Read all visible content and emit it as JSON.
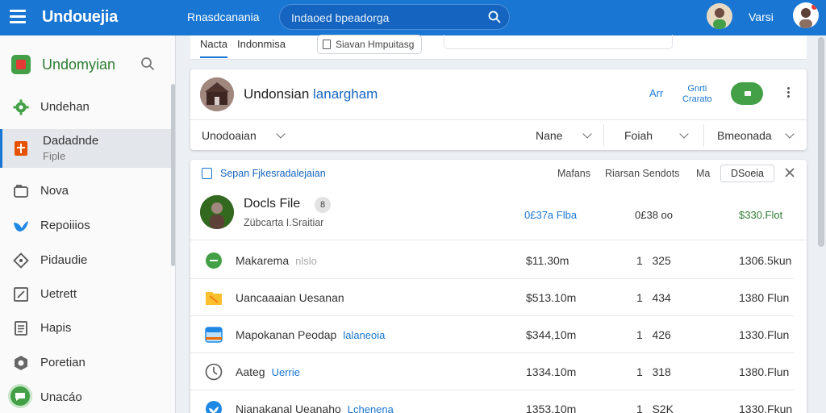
{
  "topbar": {
    "title": "Undouejia",
    "link": "Rnasdcanania",
    "search_placeholder": "Indaoed bpeadorga",
    "user_label": "Varsi"
  },
  "sidebar": {
    "title": "Undomyian",
    "items": [
      {
        "label": "Undehan",
        "icon": "gear-icon"
      },
      {
        "label": "Dadadnde",
        "sub": "Fiple",
        "icon": "bookmark-icon"
      },
      {
        "label": "Nova",
        "icon": "folder-icon"
      },
      {
        "label": "Repoiiios",
        "icon": "bird-icon"
      },
      {
        "label": "Pidaudie",
        "icon": "diamond-icon"
      },
      {
        "label": "Uetrett",
        "icon": "edit-square-icon"
      },
      {
        "label": "Hapis",
        "icon": "document-icon"
      },
      {
        "label": "Poretian",
        "icon": "hexagon-icon"
      },
      {
        "label": "Unacáo",
        "icon": "chat-icon"
      }
    ]
  },
  "tabs": {
    "tab1": "Nacta",
    "tab2": "Indonmisa",
    "chip": "Siavan Hmpuitasg"
  },
  "profile_card": {
    "name_main": "Undonsian",
    "name_highlight": "lanargham",
    "link1": "Arr",
    "link2_line1": "Gnrti",
    "link2_line2": "Crarato",
    "dropdowns": [
      "Unodoaian",
      "Nane",
      "Foiah",
      "Bmeonada"
    ]
  },
  "list_card": {
    "title": "Sepan Fjkesradalejaian",
    "header_cols": [
      "Mafans",
      "Riarsan Sendots",
      "Ma"
    ],
    "button": "DSoeia",
    "featured": {
      "name": "Docls File",
      "chip": "8",
      "sub": "Zübcarta I.Sraitiar",
      "v1": "0£37a Flba",
      "v2": "0£38 oo",
      "v3": "$330.Flot"
    },
    "rows": [
      {
        "name": "Makarema",
        "tag": "nlslo",
        "tag_style": "grey",
        "v1": "$11.30m",
        "v2": "1   325",
        "v3": "1306.5kun",
        "icon": "check-circle-icon"
      },
      {
        "name": "Uancaaaian Uesanan",
        "tag": "",
        "tag_style": "",
        "v1": "$513.10m",
        "v2": "1   434",
        "v3": "1380 Flun",
        "icon": "folder-icon"
      },
      {
        "name": "Mapokanan Peodap",
        "tag": "lalaneoia",
        "tag_style": "blue",
        "v1": "$344,10m",
        "v2": "1   426",
        "v3": "1330.Flun",
        "icon": "calendar-icon"
      },
      {
        "name": "Aateg",
        "tag": "Uerrie",
        "tag_style": "blue",
        "v1": "1334.10m",
        "v2": "1   318",
        "v3": "1380.Flun",
        "icon": "clock-icon"
      },
      {
        "name": "Nianakanal Ueanaho",
        "tag": "Lchenena",
        "tag_style": "blue",
        "v1": "1353.10m",
        "v2": "1   S2K",
        "v3": "1330.Fkun",
        "icon": "bird-icon"
      }
    ]
  },
  "colors": {
    "primary": "#1976d2",
    "accent_green": "#43a047",
    "sidebar_bg": "#fafafa",
    "page_bg": "#eceff3"
  }
}
